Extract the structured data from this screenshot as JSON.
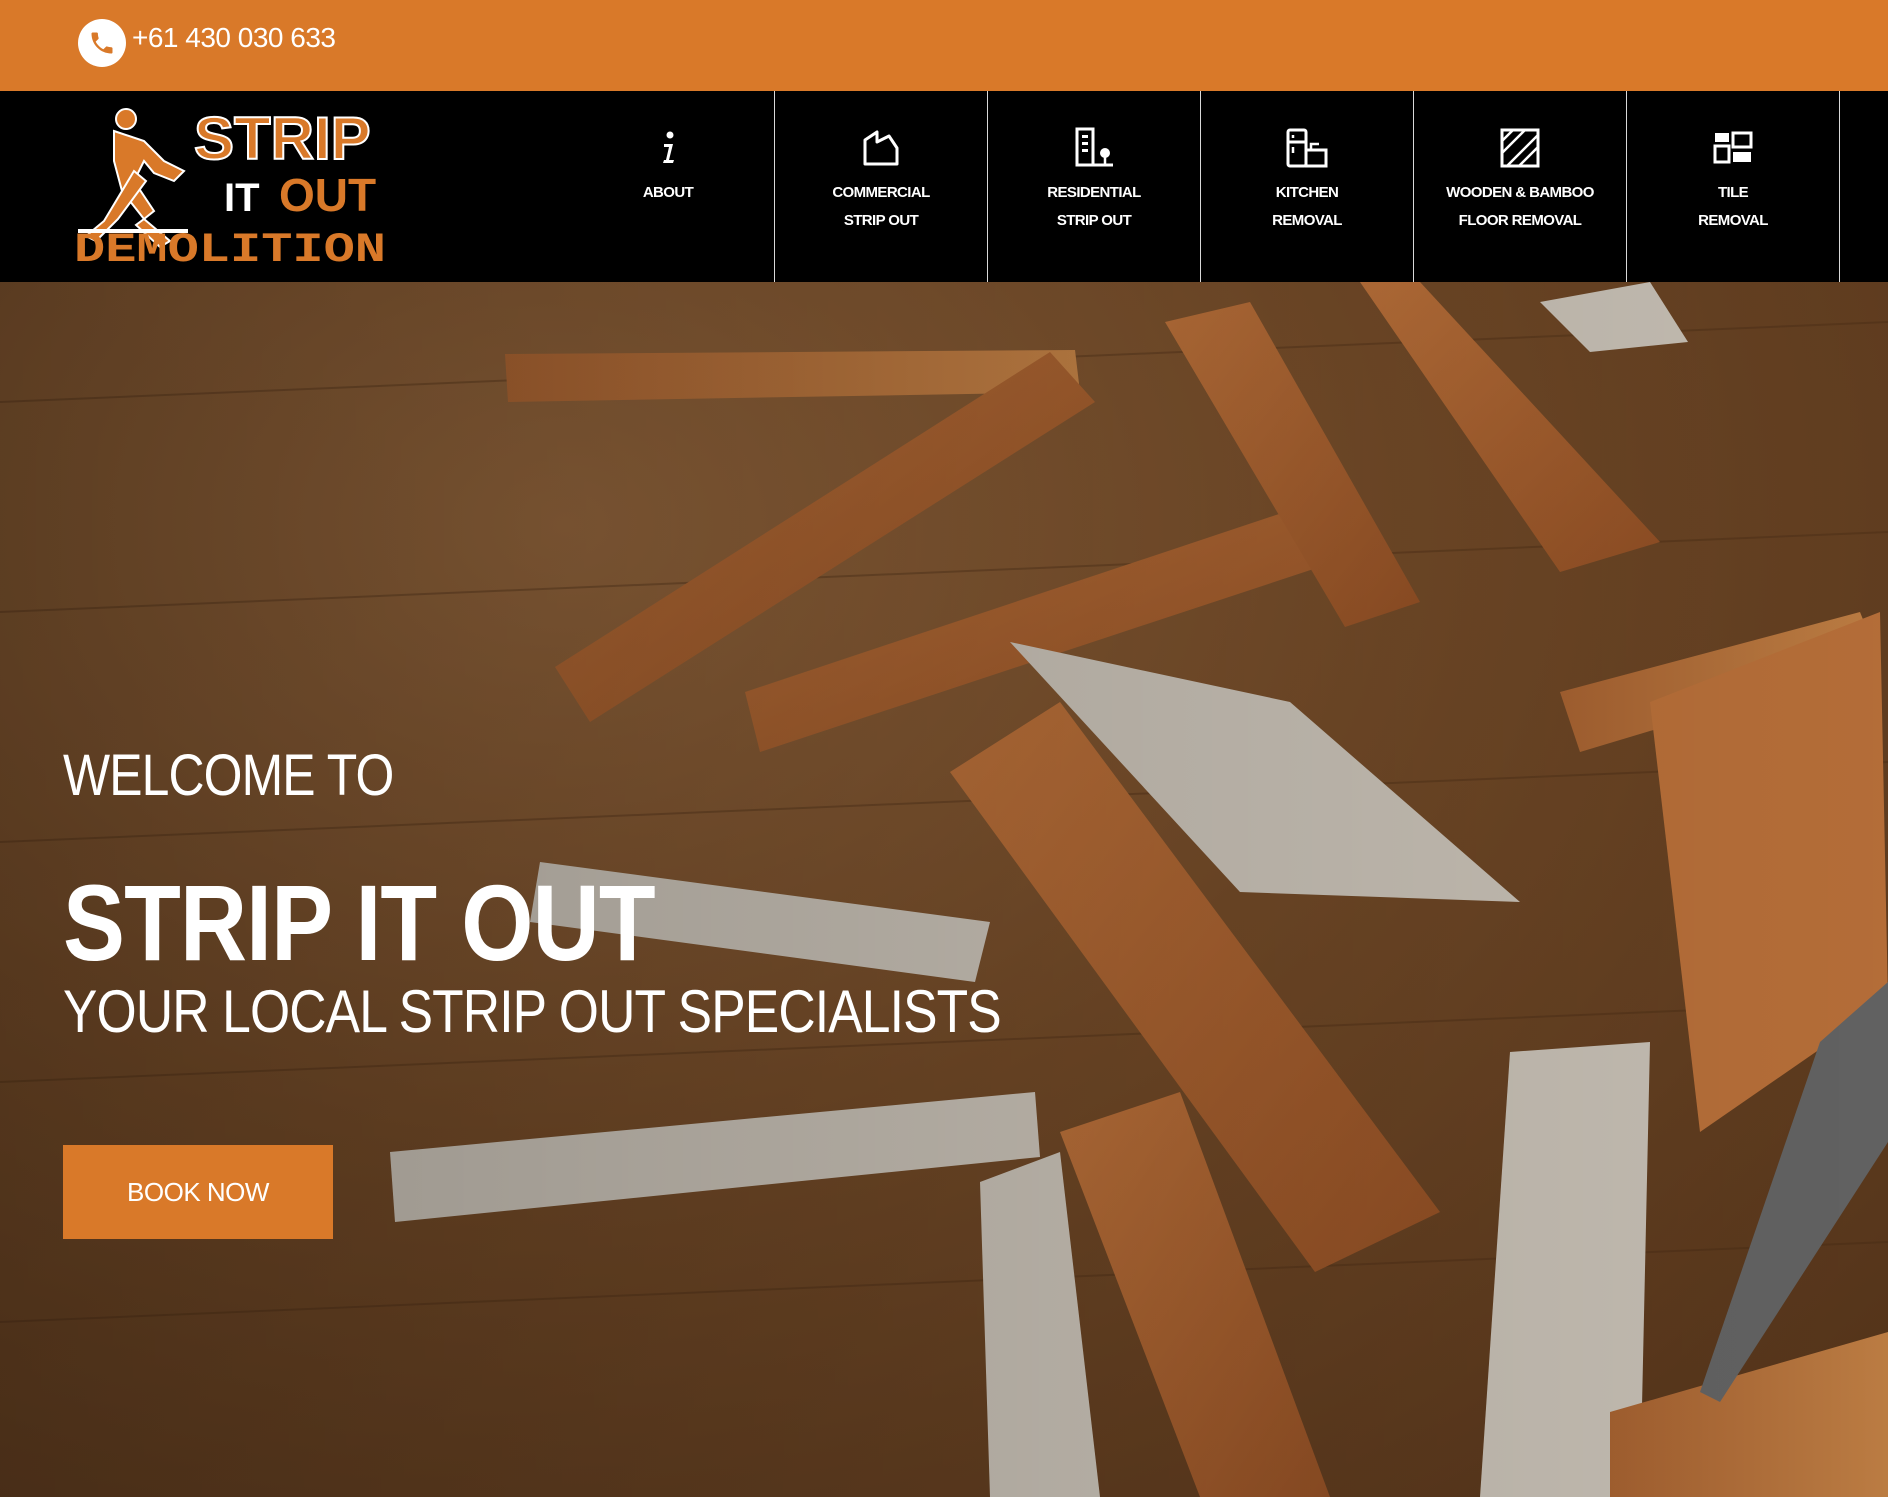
{
  "topbar": {
    "icon": "phone-icon",
    "phone": "+61 430 030 633",
    "background": "#d97929"
  },
  "header": {
    "logo": {
      "line1": "STRIP",
      "line2a": "IT",
      "line2b": "OUT",
      "line3": "DEMOLITION",
      "icon": "worker-jackhammer-icon"
    },
    "nav": [
      {
        "icon": "info-icon",
        "line1": "ABOUT",
        "line2": ""
      },
      {
        "icon": "commercial-building-icon",
        "line1": "COMMERCIAL",
        "line2": "STRIP OUT"
      },
      {
        "icon": "residential-building-icon",
        "line1": "RESIDENTIAL",
        "line2": "STRIP OUT"
      },
      {
        "icon": "kitchen-icon",
        "line1": "KITCHEN",
        "line2": "REMOVAL"
      },
      {
        "icon": "floorboards-icon",
        "line1": "WOODEN & BAMBOO",
        "line2": "FLOOR REMOVAL"
      },
      {
        "icon": "tiles-icon",
        "line1": "TILE",
        "line2": "REMOVAL"
      }
    ]
  },
  "hero": {
    "welcome": "WELCOME TO",
    "title": "STRIP IT OUT",
    "tagline": "YOUR LOCAL STRIP OUT SPECIALISTS",
    "cta": "BOOK NOW",
    "accent": "#d97929"
  }
}
